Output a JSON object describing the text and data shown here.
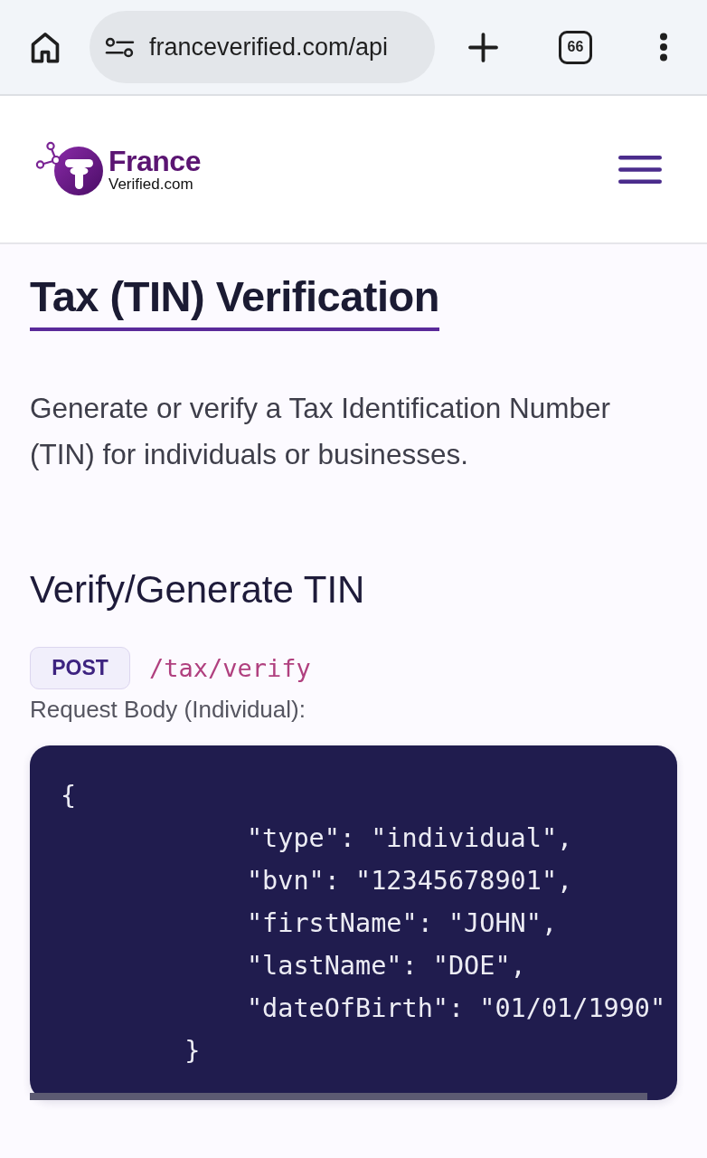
{
  "browser": {
    "url": "franceverified.com/api",
    "tab_count": "66"
  },
  "site_header": {
    "logo": {
      "name": "France",
      "suffix": "Verified.com"
    }
  },
  "page": {
    "title": "Tax (TIN) Verification",
    "description": "Generate or verify a Tax Identification Number (TIN) for individuals or businesses."
  },
  "endpoint": {
    "heading": "Verify/Generate TIN",
    "method": "POST",
    "path": "/tax/verify",
    "body_label": "Request Body (Individual):",
    "code_lines": [
      "{",
      "            \"type\": \"individual\",",
      "            \"bvn\": \"12345678901\",",
      "            \"firstName\": \"JOHN\",",
      "            \"lastName\": \"DOE\",",
      "            \"dateOfBirth\": \"01/01/1990\"",
      "        }"
    ]
  }
}
